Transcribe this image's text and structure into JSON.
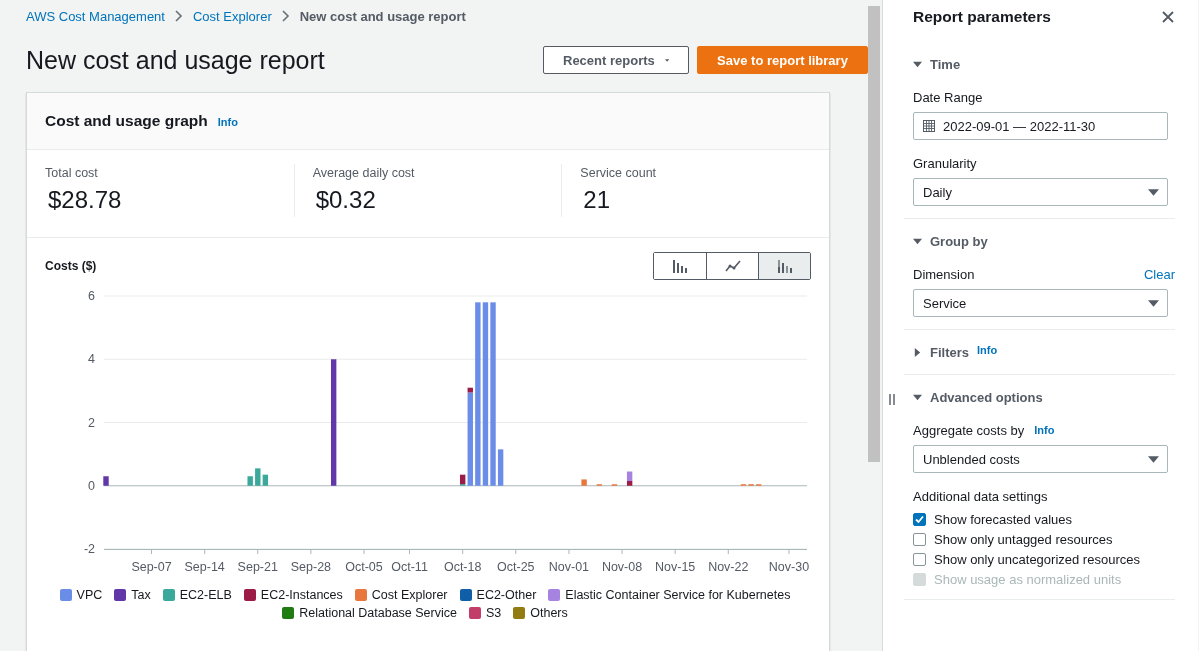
{
  "breadcrumb": [
    {
      "label": "AWS Cost Management",
      "kind": "link"
    },
    {
      "label": "Cost Explorer",
      "kind": "link"
    },
    {
      "label": "New cost and usage report",
      "kind": "current"
    }
  ],
  "page_title": "New cost and usage report",
  "actions": [
    {
      "label": "Recent reports",
      "kind": "dropdown"
    },
    {
      "label": "Save to report library",
      "kind": "primary"
    }
  ],
  "graph_card": {
    "title": "Cost and usage graph",
    "info": "Info",
    "stats": [
      {
        "label": "Total cost",
        "value": "$28.78"
      },
      {
        "label": "Average daily cost",
        "value": "$0.32"
      },
      {
        "label": "Service count",
        "value": "21"
      }
    ],
    "chart_types": [
      {
        "kind": "bar",
        "selected": false
      },
      {
        "kind": "line",
        "selected": false
      },
      {
        "kind": "stacked",
        "selected": true
      }
    ],
    "chart_data": {
      "type": "bar",
      "stacked": true,
      "ylabel": "Costs ($)",
      "ylim": [
        -2,
        6
      ],
      "yticks": [
        -2,
        0,
        2,
        4,
        6
      ],
      "categories": [
        null,
        null,
        null,
        null,
        null,
        null,
        "Sep-07",
        null,
        null,
        null,
        null,
        null,
        null,
        "Sep-14",
        null,
        null,
        null,
        null,
        null,
        null,
        "Sep-21",
        null,
        null,
        null,
        null,
        null,
        null,
        "Sep-28",
        null,
        null,
        null,
        null,
        null,
        null,
        "Oct-05",
        null,
        null,
        null,
        null,
        null,
        "Oct-11",
        null,
        null,
        null,
        null,
        null,
        null,
        "Oct-18",
        null,
        null,
        null,
        null,
        null,
        null,
        "Oct-25",
        null,
        null,
        null,
        null,
        null,
        null,
        "Nov-01",
        null,
        null,
        null,
        null,
        null,
        null,
        "Nov-08",
        null,
        null,
        null,
        null,
        null,
        null,
        "Nov-15",
        null,
        null,
        null,
        null,
        null,
        null,
        "Nov-22",
        null,
        null,
        null,
        null,
        null,
        null,
        null,
        "Nov-30"
      ],
      "series": [
        {
          "name": "VPC",
          "color": "#6a8de8",
          "values": [
            0,
            0,
            0,
            0,
            0,
            0,
            0,
            0,
            0,
            0,
            0,
            0,
            0,
            0,
            0,
            0,
            0,
            0,
            0,
            0,
            0,
            0,
            0,
            0,
            0,
            0,
            0,
            0,
            0,
            0,
            0,
            0,
            0,
            0,
            0,
            0,
            0,
            0,
            0,
            0,
            0,
            0,
            0,
            0,
            0,
            0,
            0,
            0,
            2.95,
            5.8,
            5.8,
            5.8,
            1.15,
            0,
            0,
            0,
            0,
            0,
            0,
            0,
            0,
            0,
            0,
            0,
            0,
            0,
            0,
            0,
            0,
            0,
            0,
            0,
            0,
            0,
            0,
            0,
            0,
            0,
            0,
            0,
            0,
            0,
            0,
            0,
            0,
            0,
            0,
            0,
            0,
            0,
            0
          ]
        },
        {
          "name": "Tax",
          "color": "#6237a7",
          "values": [
            0.3,
            0,
            0,
            0,
            0,
            0,
            0,
            0,
            0,
            0,
            0,
            0,
            0,
            0,
            0,
            0,
            0,
            0,
            0,
            0,
            0,
            0,
            0,
            0,
            0,
            0,
            0,
            0,
            0,
            0,
            4,
            0,
            0,
            0,
            0,
            0,
            0,
            0,
            0,
            0,
            0,
            0,
            0,
            0,
            0,
            0,
            0,
            0,
            0,
            0,
            0,
            0,
            0,
            0,
            0,
            0,
            0,
            0,
            0,
            0,
            0,
            0,
            0,
            0,
            0,
            0,
            0,
            0,
            0,
            0,
            0,
            0,
            0,
            0,
            0,
            0,
            0,
            0,
            0,
            0,
            0,
            0,
            0,
            0,
            0,
            0,
            0,
            0,
            0,
            0,
            0
          ]
        },
        {
          "name": "EC2-ELB",
          "color": "#3aa89a",
          "values": [
            0,
            0,
            0,
            0,
            0,
            0,
            0,
            0,
            0,
            0,
            0,
            0,
            0,
            0,
            0,
            0,
            0,
            0,
            0,
            0.3,
            0.55,
            0.35,
            0,
            0,
            0,
            0,
            0,
            0,
            0,
            0,
            0,
            0,
            0,
            0,
            0,
            0,
            0,
            0,
            0,
            0,
            0,
            0,
            0,
            0,
            0,
            0,
            0,
            0.05,
            0,
            0,
            0,
            0,
            0,
            0,
            0,
            0,
            0,
            0,
            0,
            0,
            0,
            0,
            0,
            0,
            0,
            0,
            0,
            0,
            0,
            0,
            0,
            0,
            0,
            0,
            0,
            0,
            0,
            0,
            0,
            0,
            0,
            0,
            0,
            0,
            0,
            0,
            0,
            0,
            0,
            0,
            0
          ]
        },
        {
          "name": "EC2-Instances",
          "color": "#9b1d47",
          "values": [
            0,
            0,
            0,
            0,
            0,
            0,
            0,
            0,
            0,
            0,
            0,
            0,
            0,
            0,
            0,
            0,
            0,
            0,
            0,
            0,
            0,
            0,
            0,
            0,
            0,
            0,
            0,
            0,
            0,
            0,
            0,
            0,
            0,
            0,
            0,
            0,
            0,
            0,
            0,
            0,
            0,
            0,
            0,
            0,
            0,
            0,
            0,
            0.3,
            0.15,
            0,
            0,
            0,
            0,
            0,
            0,
            0,
            0,
            0,
            0,
            0,
            0,
            0,
            0,
            0,
            0,
            0,
            0,
            0,
            0,
            0.15,
            0,
            0,
            0,
            0,
            0,
            0,
            0,
            0,
            0,
            0,
            0,
            0,
            0,
            0,
            0,
            0,
            0,
            0,
            0,
            0,
            0
          ]
        },
        {
          "name": "Cost Explorer",
          "color": "#e8773d",
          "values": [
            0,
            0,
            0,
            0,
            0,
            0,
            0,
            0,
            0,
            0,
            0,
            0,
            0,
            0,
            0,
            0,
            0,
            0,
            0,
            0,
            0,
            0,
            0,
            0,
            0,
            0,
            0,
            0,
            0,
            0,
            0,
            0,
            0,
            0,
            0,
            0,
            0,
            0,
            0,
            0,
            0,
            0,
            0,
            0,
            0,
            0,
            0,
            0,
            0,
            0,
            0,
            0,
            0,
            0,
            0,
            0,
            0,
            0,
            0,
            0,
            0,
            0,
            0,
            0.2,
            0,
            0.02,
            0,
            0.02,
            0,
            0,
            0,
            0,
            0,
            0,
            0,
            0,
            0,
            0,
            0,
            0,
            0,
            0,
            0,
            0,
            0.02,
            0.05,
            0.04,
            0,
            0,
            0,
            0
          ]
        },
        {
          "name": "EC2-Other",
          "color": "#0f5fa8",
          "values": [
            0,
            0,
            0,
            0,
            0,
            0,
            0,
            0,
            0,
            0,
            0,
            0,
            0,
            0,
            0,
            0,
            0,
            0,
            0,
            0,
            0,
            0,
            0,
            0,
            0,
            0,
            0,
            0,
            0,
            0,
            0,
            0,
            0,
            0,
            0,
            0,
            0,
            0,
            0,
            0,
            0,
            0,
            0,
            0,
            0,
            0,
            0,
            0,
            0,
            0,
            0,
            0,
            0,
            0,
            0,
            0,
            0,
            0,
            0,
            0,
            0,
            0,
            0,
            0,
            0,
            0,
            0,
            0,
            0,
            0,
            0,
            0,
            0,
            0,
            0,
            0,
            0,
            0,
            0,
            0,
            0,
            0,
            0,
            0,
            0,
            0,
            0,
            0,
            0,
            0,
            0
          ]
        },
        {
          "name": "Elastic Container Service for Kubernetes",
          "color": "#a783e1",
          "values": [
            0,
            0,
            0,
            0,
            0,
            0,
            0,
            0,
            0,
            0,
            0,
            0,
            0,
            0,
            0,
            0,
            0,
            0,
            0,
            0,
            0,
            0,
            0,
            0,
            0,
            0,
            0,
            0,
            0,
            0,
            0,
            0,
            0,
            0,
            0,
            0,
            0,
            0,
            0,
            0,
            0,
            0,
            0,
            0,
            0,
            0,
            0,
            0,
            0,
            0,
            0,
            0,
            0,
            0,
            0,
            0,
            0,
            0,
            0,
            0,
            0,
            0,
            0,
            0,
            0,
            0,
            0,
            0,
            0,
            0.3,
            0,
            0,
            0,
            0,
            0,
            0,
            0,
            0,
            0,
            0,
            0,
            0,
            0,
            0,
            0,
            0,
            0,
            0,
            0,
            0,
            0
          ]
        },
        {
          "name": "Relational Database Service",
          "color": "#1e7c12",
          "values": [
            0,
            0,
            0,
            0,
            0,
            0,
            0,
            0,
            0,
            0,
            0,
            0,
            0,
            0,
            0,
            0,
            0,
            0,
            0,
            0,
            0,
            0,
            0,
            0,
            0,
            0,
            0,
            0,
            0,
            0,
            0,
            0,
            0,
            0,
            0,
            0,
            0,
            0,
            0,
            0,
            0,
            0,
            0,
            0,
            0,
            0,
            0,
            0,
            0,
            0,
            0,
            0,
            0,
            0,
            0,
            0,
            0,
            0,
            0,
            0,
            0,
            0,
            0,
            0,
            0,
            0,
            0,
            0,
            0,
            0,
            0,
            0,
            0,
            0,
            0,
            0,
            0,
            0,
            0,
            0,
            0,
            0,
            0,
            0,
            0,
            0,
            0,
            0,
            0,
            0,
            0
          ]
        },
        {
          "name": "S3",
          "color": "#c33d69",
          "values": [
            0,
            0,
            0,
            0,
            0,
            0,
            0,
            0,
            0,
            0,
            0,
            0,
            0,
            0,
            0,
            0,
            0,
            0,
            0,
            0,
            0,
            0,
            0,
            0,
            0,
            0,
            0,
            0,
            0,
            0,
            0,
            0,
            0,
            0,
            0,
            0,
            0,
            0,
            0,
            0,
            0,
            0,
            0,
            0,
            0,
            0,
            0,
            0,
            0,
            0,
            0,
            0,
            0,
            0,
            0,
            0,
            0,
            0,
            0,
            0,
            0,
            0,
            0,
            0,
            0,
            0,
            0,
            0,
            0,
            0,
            0,
            0,
            0,
            0,
            0,
            0,
            0,
            0,
            0,
            0,
            0,
            0,
            0,
            0,
            0,
            0,
            0,
            0,
            0,
            0,
            0
          ]
        },
        {
          "name": "Others",
          "color": "#927b10",
          "values": [
            0,
            0,
            0,
            0,
            0,
            0,
            0,
            0,
            0,
            0,
            0,
            0,
            0,
            0,
            0,
            0,
            0,
            0,
            0,
            0,
            0,
            0,
            0,
            0,
            0,
            0,
            0,
            0,
            0,
            0,
            0,
            0,
            0,
            0,
            0,
            0,
            0,
            0,
            0,
            0,
            0,
            0,
            0,
            0,
            0,
            0,
            0,
            0,
            0,
            0,
            0,
            0,
            0,
            0,
            0,
            0,
            0,
            0,
            0,
            0,
            0,
            0,
            0,
            0,
            0,
            0,
            0,
            0,
            0,
            0,
            0,
            0,
            0,
            0,
            0,
            0,
            0,
            0,
            0,
            0,
            0,
            0,
            0,
            0,
            0,
            0,
            0,
            0,
            0,
            0,
            0
          ]
        }
      ]
    }
  },
  "panel": {
    "title": "Report parameters",
    "sections": [
      {
        "title": "Time",
        "expanded": true,
        "fields": [
          {
            "kind": "date",
            "label": "Date Range",
            "value": "2022-09-01 — 2022-11-30"
          },
          {
            "kind": "select",
            "label": "Granularity",
            "value": "Daily"
          }
        ]
      },
      {
        "title": "Group by",
        "expanded": true,
        "fields": [
          {
            "kind": "select",
            "label": "Dimension",
            "action": "Clear",
            "value": "Service"
          }
        ]
      },
      {
        "title": "Filters",
        "expanded": false,
        "info": "Info"
      },
      {
        "title": "Advanced options",
        "expanded": true,
        "fields": [
          {
            "kind": "select",
            "label": "Aggregate costs by",
            "info": "Info",
            "value": "Unblended costs"
          },
          {
            "kind": "checkboxes",
            "label": "Additional data settings",
            "options": [
              {
                "label": "Show forecasted values",
                "checked": true,
                "disabled": false
              },
              {
                "label": "Show only untagged resources",
                "checked": false,
                "disabled": false
              },
              {
                "label": "Show only uncategorized resources",
                "checked": false,
                "disabled": false
              },
              {
                "label": "Show usage as normalized units",
                "checked": false,
                "disabled": true
              }
            ]
          }
        ]
      }
    ]
  }
}
